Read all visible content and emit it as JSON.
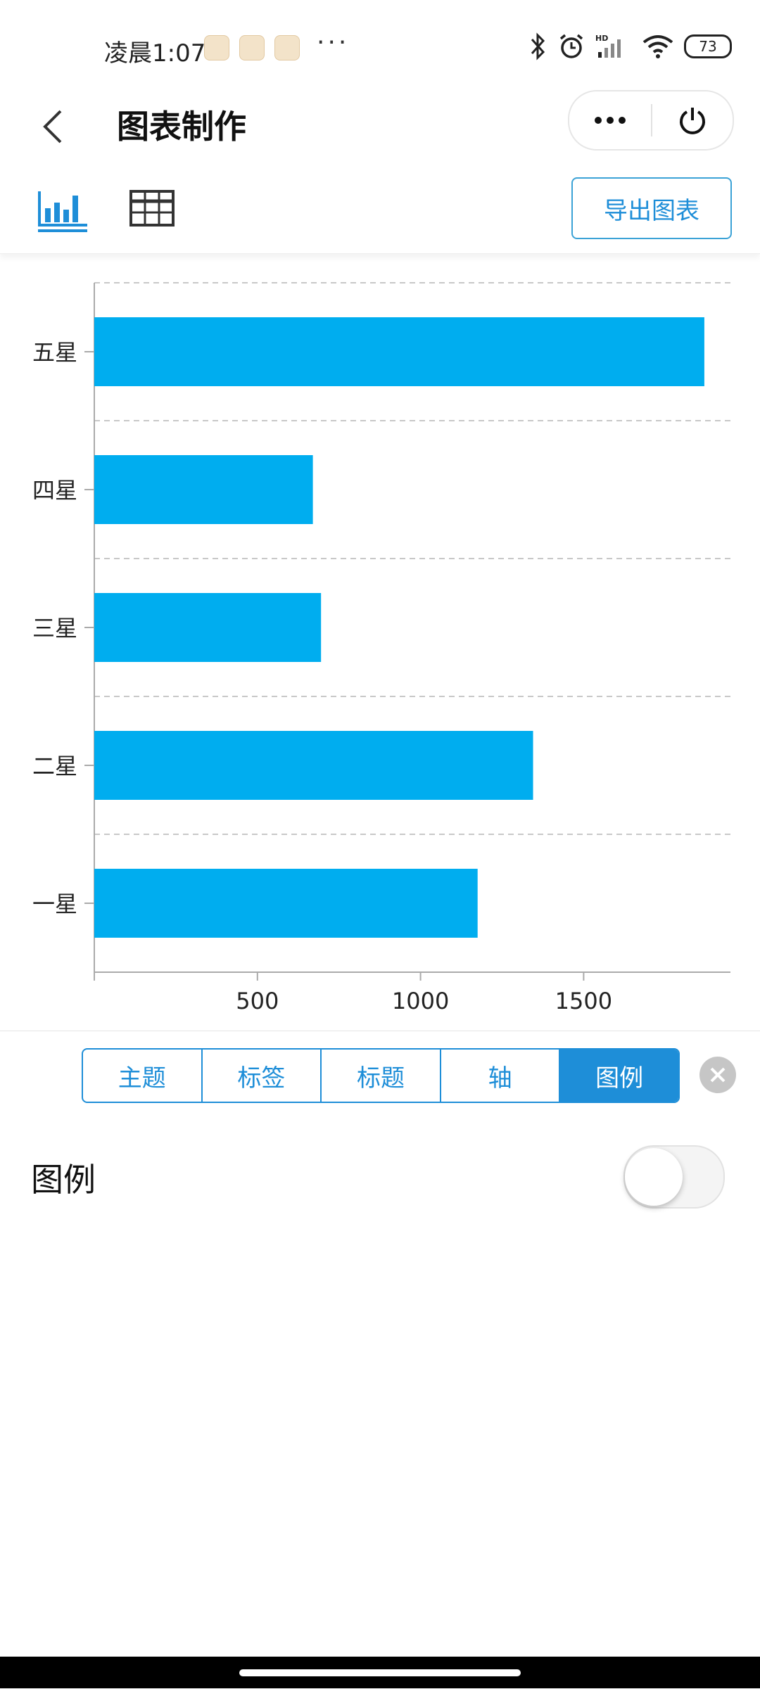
{
  "status_bar": {
    "time": "凌晨1:07",
    "more": "···",
    "battery": "73",
    "icons": [
      "app-note-icon",
      "app-download-icon",
      "app-sketch-icon",
      "bluetooth-icon",
      "alarm-icon",
      "hd-signal-icon",
      "wifi-icon",
      "battery-icon"
    ]
  },
  "header": {
    "title": "图表制作",
    "more_icon": "more-dots-icon",
    "power_icon": "power-icon"
  },
  "toolbar": {
    "chart_icon": "bar-chart-icon",
    "table_icon": "table-icon",
    "export_label": "导出图表",
    "accent": "#1e8ed8"
  },
  "chart_data": {
    "type": "bar",
    "orientation": "horizontal",
    "categories": [
      "五星",
      "四星",
      "三星",
      "二星",
      "一星"
    ],
    "values": [
      1870,
      670,
      695,
      1345,
      1175
    ],
    "x_ticks": [
      "500",
      "1000",
      "1500"
    ],
    "xlim": [
      0,
      1950
    ],
    "grid": "horizontal-dashed",
    "color": "#00adef",
    "title": "",
    "xlabel": "",
    "ylabel": ""
  },
  "panel": {
    "tabs": [
      {
        "label": "主题",
        "active": false
      },
      {
        "label": "标签",
        "active": false
      },
      {
        "label": "标题",
        "active": false
      },
      {
        "label": "轴",
        "active": false
      },
      {
        "label": "图例",
        "active": true
      }
    ],
    "close_icon": "close-icon",
    "legend_label": "图例",
    "legend_toggle_on": false
  }
}
